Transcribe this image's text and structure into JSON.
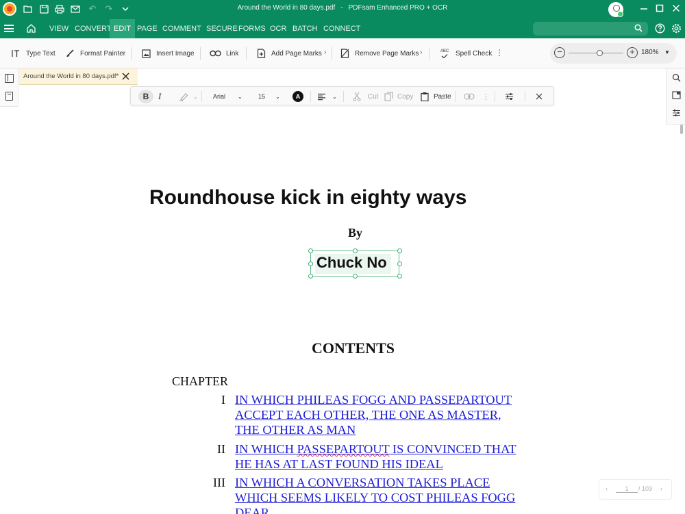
{
  "titlebar": {
    "file_name": "Around the World in 80 days.pdf",
    "separator": "-",
    "app_name": "PDFsam Enhanced PRO + OCR"
  },
  "menu": {
    "items": [
      "VIEW",
      "CONVERT",
      "EDIT",
      "PAGE",
      "COMMENT",
      "SECURE",
      "FORMS",
      "OCR",
      "BATCH",
      "CONNECT"
    ],
    "active": "EDIT"
  },
  "toolbar": {
    "type_text": "Type Text",
    "format_painter": "Format Painter",
    "insert_image": "Insert Image",
    "link": "Link",
    "add_page_marks": "Add Page Marks",
    "remove_page_marks": "Remove Page Marks",
    "spell_check": "Spell Check",
    "spell_icon_text": "ABC",
    "zoom_value": "180%"
  },
  "doc_tab": {
    "label": "Around the World in 80 days.pdf*"
  },
  "format_bar": {
    "bold": "B",
    "italic": "I",
    "font": "Arial",
    "size": "15",
    "color_label": "A",
    "cut": "Cut",
    "copy": "Copy",
    "paste": "Paste"
  },
  "document": {
    "title": "Roundhouse kick in eighty ways",
    "by": "By",
    "author": "Chuck No",
    "contents_heading": "CONTENTS",
    "chapter_label": "CHAPTER",
    "toc": [
      {
        "numeral": "I",
        "lines": [
          "IN WHICH PHILEAS FOGG AND PASSEPARTOUT",
          "ACCEPT EACH OTHER, THE ONE AS MASTER,",
          "THE OTHER AS MAN"
        ]
      },
      {
        "numeral": "II",
        "lines": [
          "IN WHICH ",
          "PASSEPARTOUT",
          " IS CONVINCED THAT",
          "HE HAS AT LAST FOUND HIS IDEAL"
        ]
      },
      {
        "numeral": "III",
        "lines": [
          "IN WHICH A CONVERSATION TAKES PLACE",
          "WHICH SEEMS LIKELY TO COST PHILEAS FOGG",
          "DEAR"
        ]
      }
    ]
  },
  "page_nav": {
    "current": "1",
    "total": "/ 103"
  }
}
